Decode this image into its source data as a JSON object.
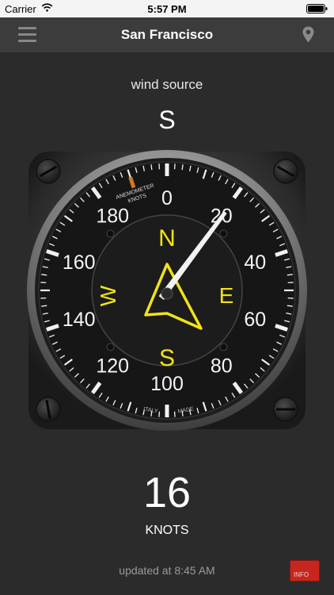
{
  "status_bar": {
    "carrier": "Carrier",
    "time": "5:57 PM"
  },
  "nav": {
    "title": "San Francisco",
    "menu_icon": "hamburger-icon",
    "location_icon": "location-pin-icon"
  },
  "wind": {
    "source_label": "wind source",
    "direction": "S"
  },
  "gauge": {
    "brand_line1": "ANEMOMETER",
    "brand_line2": "KNOTS",
    "footer_left": "ITALY",
    "footer_right": "MADE",
    "compass": [
      "N",
      "E",
      "S",
      "W"
    ],
    "scale": [
      {
        "v": 0,
        "label": "0"
      },
      {
        "v": 20,
        "label": "20"
      },
      {
        "v": 40,
        "label": "40"
      },
      {
        "v": 60,
        "label": "60"
      },
      {
        "v": 80,
        "label": "80"
      },
      {
        "v": 100,
        "label": "100"
      },
      {
        "v": 120,
        "label": "120"
      },
      {
        "v": 140,
        "label": "140"
      },
      {
        "v": 160,
        "label": "160"
      },
      {
        "v": 180,
        "label": "180"
      }
    ],
    "scale_max": 200,
    "speed_knots": 16,
    "arrow_points_to": "S",
    "accent_color": "#f1e21b"
  },
  "speed": {
    "value": "16",
    "unit": "KNOTS"
  },
  "updated": "updated at 8:45 AM",
  "info_button": {
    "label": "INFO",
    "color": "#c7261e"
  }
}
